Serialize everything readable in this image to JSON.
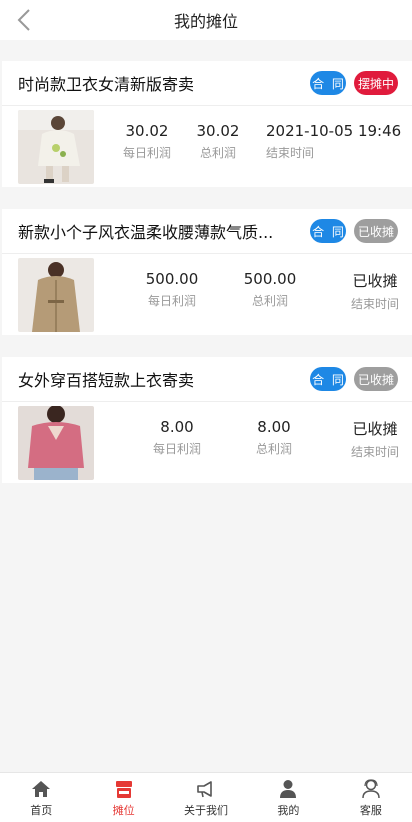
{
  "header": {
    "title": "我的摊位"
  },
  "labels": {
    "contract": "合 同",
    "daily_profit": "每日利润",
    "total_profit": "总利润",
    "end_time": "结束时间"
  },
  "colors": {
    "accent_red": "#e53935",
    "contract_blue": "#1e88e5",
    "status_active": "#e01b3c",
    "status_closed": "#9e9e9e"
  },
  "items": [
    {
      "title": "时尚款卫衣女清新版寄卖",
      "status": "摆摊中",
      "status_type": "active",
      "daily_profit": "30.02",
      "total_profit": "30.02",
      "end_time": "2021-10-05 19:46"
    },
    {
      "title": "新款小个子风衣温柔收腰薄款气质...",
      "status": "已收摊",
      "status_type": "closed",
      "daily_profit": "500.00",
      "total_profit": "500.00",
      "end_time": "已收摊"
    },
    {
      "title": "女外穿百搭短款上衣寄卖",
      "status": "已收摊",
      "status_type": "closed",
      "daily_profit": "8.00",
      "total_profit": "8.00",
      "end_time": "已收摊"
    }
  ],
  "nav": {
    "home": "首页",
    "stall": "摊位",
    "about": "关于我们",
    "mine": "我的",
    "service": "客服"
  }
}
